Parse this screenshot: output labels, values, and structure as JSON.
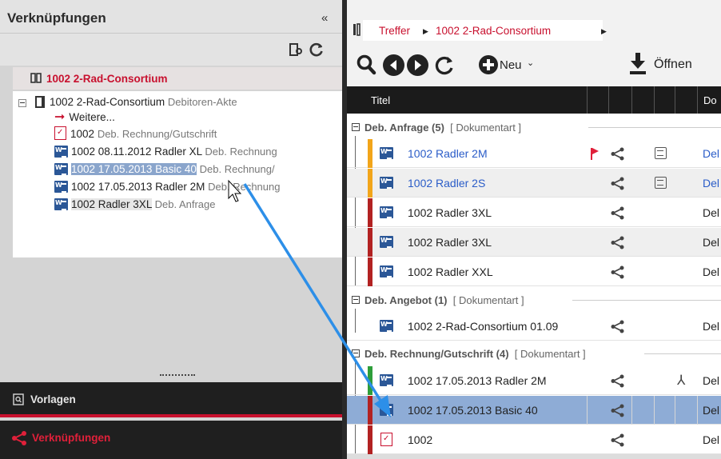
{
  "left_panel": {
    "title": "Verknüpfungen",
    "collapse_glyph": "«",
    "root": {
      "label": "1002 2-Rad-Consortium"
    },
    "tree": {
      "root_label": "1002 2-Rad-Consortium",
      "root_sub": "Debitoren-Akte",
      "more_label": "Weitere...",
      "items": [
        {
          "a": "1002",
          "b": "Deb. Rechnung/Gutschrift",
          "icon": "pdf-icon"
        },
        {
          "a": "1002   08.11.2012 Radler XL",
          "b": "Deb. Rechnung",
          "icon": "word-icon"
        },
        {
          "a": "1002   17.05.2013  Basic 40",
          "b": "Deb. Rechnung/",
          "icon": "word-icon"
        },
        {
          "a": "1002   17.05.2013  Radler 2M",
          "b": "Deb. Rechnung",
          "icon": "word-icon"
        },
        {
          "a": "1002 Radler 3XL",
          "b": "Deb. Anfrage",
          "icon": "word-icon"
        }
      ]
    },
    "nav": [
      {
        "label": "Vorlagen",
        "icon": "search-doc-icon"
      },
      {
        "label": "Verknüpfungen",
        "icon": "share-icon"
      }
    ]
  },
  "right_panel": {
    "breadcrumb": [
      "Treffer",
      "1002 2-Rad-Consortium"
    ],
    "toolbar": {
      "new_label": "Neu",
      "open_label": "Öffnen"
    },
    "columns": {
      "title": "Titel",
      "right": "Do"
    },
    "groups": [
      {
        "name": "Deb. Anfrage (5)",
        "type": "[ Dokumentart ]"
      },
      {
        "name": "Deb. Angebot (1)",
        "type": "[ Dokumentart ]"
      },
      {
        "name": "Deb. Rechnung/Gutschrift (4)",
        "type": "[ Dokumentart ]"
      }
    ],
    "rows": [
      {
        "title": "1002 Radler 2M",
        "right": "Del",
        "bar": "#f2a51a",
        "blue": true
      },
      {
        "title": "1002 Radler 2S",
        "right": "Del",
        "bar": "#f2a51a",
        "blue": true
      },
      {
        "title": "1002 Radler 3XL",
        "right": "Del",
        "bar": "#b22222"
      },
      {
        "title": "1002 Radler 3XL",
        "right": "Del",
        "bar": "#b22222"
      },
      {
        "title": "1002 Radler XXL",
        "right": "Del",
        "bar": "#b22222"
      },
      {
        "title": "1002 2-Rad-Consortium 01.09",
        "right": "Del",
        "bar": "none"
      },
      {
        "title": "1002   17.05.2013  Radler 2M",
        "right": "Del",
        "bar": "#2e9e3a"
      },
      {
        "title": "1002   17.05.2013   Basic 40",
        "right": "Del",
        "bar": "#b22222"
      },
      {
        "title": "1002",
        "right": "Del",
        "bar": "#b22222"
      }
    ],
    "colors": {
      "accent": "#c8102e",
      "selected": "#8eacd6",
      "link_blue": "#2a5cc8",
      "arrow": "#2d8fe8"
    }
  }
}
